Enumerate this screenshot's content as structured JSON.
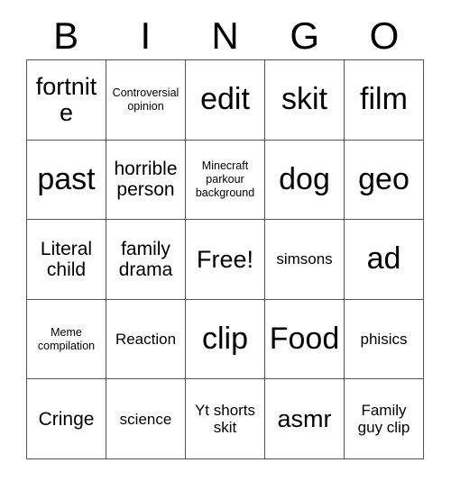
{
  "card": {
    "header_letters": [
      "B",
      "I",
      "N",
      "G",
      "O"
    ],
    "rows": [
      [
        {
          "text": "fortnite",
          "size": "sz-l"
        },
        {
          "text": "Controversial opinion",
          "size": "sz-xs"
        },
        {
          "text": "edit",
          "size": "sz-xl"
        },
        {
          "text": "skit",
          "size": "sz-xl"
        },
        {
          "text": "film",
          "size": "sz-xl"
        }
      ],
      [
        {
          "text": "past",
          "size": "sz-xl"
        },
        {
          "text": "horrible person",
          "size": "sz-m"
        },
        {
          "text": "Minecraft parkour background",
          "size": "sz-xs"
        },
        {
          "text": "dog",
          "size": "sz-xl"
        },
        {
          "text": "geo",
          "size": "sz-xl"
        }
      ],
      [
        {
          "text": "Literal child",
          "size": "sz-m"
        },
        {
          "text": "family drama",
          "size": "sz-m"
        },
        {
          "text": "Free!",
          "size": "sz-l"
        },
        {
          "text": "simsons",
          "size": "sz-s"
        },
        {
          "text": "ad",
          "size": "sz-xl"
        }
      ],
      [
        {
          "text": "Meme compilation",
          "size": "sz-xs"
        },
        {
          "text": "Reaction",
          "size": "sz-s"
        },
        {
          "text": "clip",
          "size": "sz-xl"
        },
        {
          "text": "Food",
          "size": "sz-xl"
        },
        {
          "text": "phisics",
          "size": "sz-s"
        }
      ],
      [
        {
          "text": "Cringe",
          "size": "sz-m"
        },
        {
          "text": "science",
          "size": "sz-s"
        },
        {
          "text": "Yt shorts skit",
          "size": "sz-s"
        },
        {
          "text": "asmr",
          "size": "sz-l"
        },
        {
          "text": "Family guy clip",
          "size": "sz-s"
        }
      ]
    ]
  }
}
